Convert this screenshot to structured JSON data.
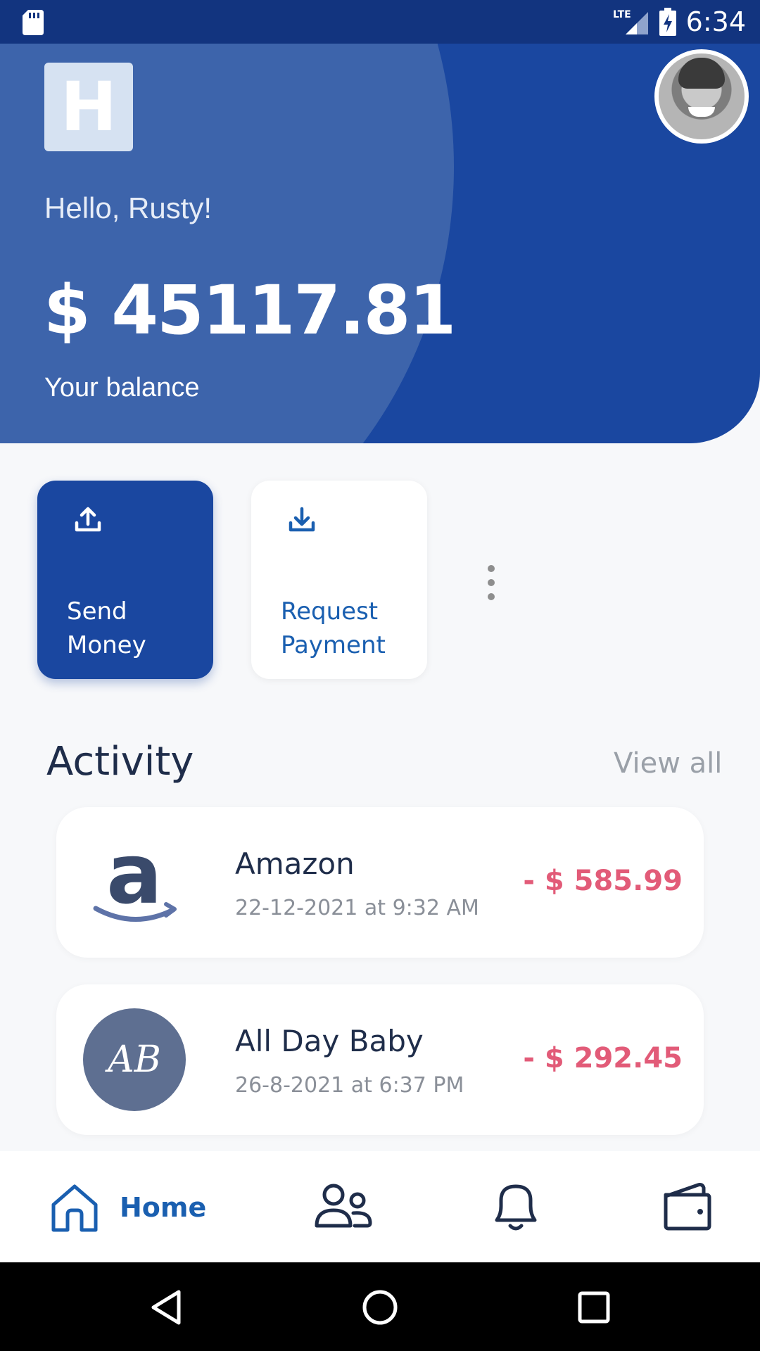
{
  "status_bar": {
    "time": "6:34",
    "network": "LTE",
    "icons": [
      "sd-card-icon",
      "lte-signal-icon",
      "battery-charging-icon"
    ]
  },
  "header": {
    "logo_letter": "H",
    "greeting": "Hello, Rusty!",
    "balance": "$ 45117.81",
    "balance_label": "Your balance",
    "avatar": "profile-avatar"
  },
  "actions": {
    "send": {
      "label": "Send Money",
      "icon": "upload-icon"
    },
    "request": {
      "label": "Request Payment",
      "icon": "download-icon"
    },
    "more_icon": "more-vertical-icon"
  },
  "activity": {
    "title": "Activity",
    "view_all": "View all",
    "transactions": [
      {
        "merchant": "Amazon",
        "date": "22-12-2021 at 9:32 AM",
        "amount": "- $ 585.99",
        "logo": "amazon-logo"
      },
      {
        "merchant": "All Day Baby",
        "date": "26-8-2021 at 6:37 PM",
        "amount": "- $ 292.45",
        "logo": "all-day-baby-logo",
        "logo_text": "AB"
      }
    ]
  },
  "bottom_nav": {
    "items": [
      {
        "label": "Home",
        "icon": "home-icon",
        "active": true
      },
      {
        "label": "",
        "icon": "people-icon"
      },
      {
        "label": "",
        "icon": "bell-icon"
      },
      {
        "label": "",
        "icon": "wallet-icon"
      }
    ]
  },
  "system_nav": [
    "back-icon",
    "home-circle-icon",
    "recents-icon"
  ],
  "colors": {
    "primary": "#1a47a0",
    "accent_blue": "#1a5fb0",
    "negative_amount": "#e25b78",
    "status_bar": "#12347f"
  }
}
